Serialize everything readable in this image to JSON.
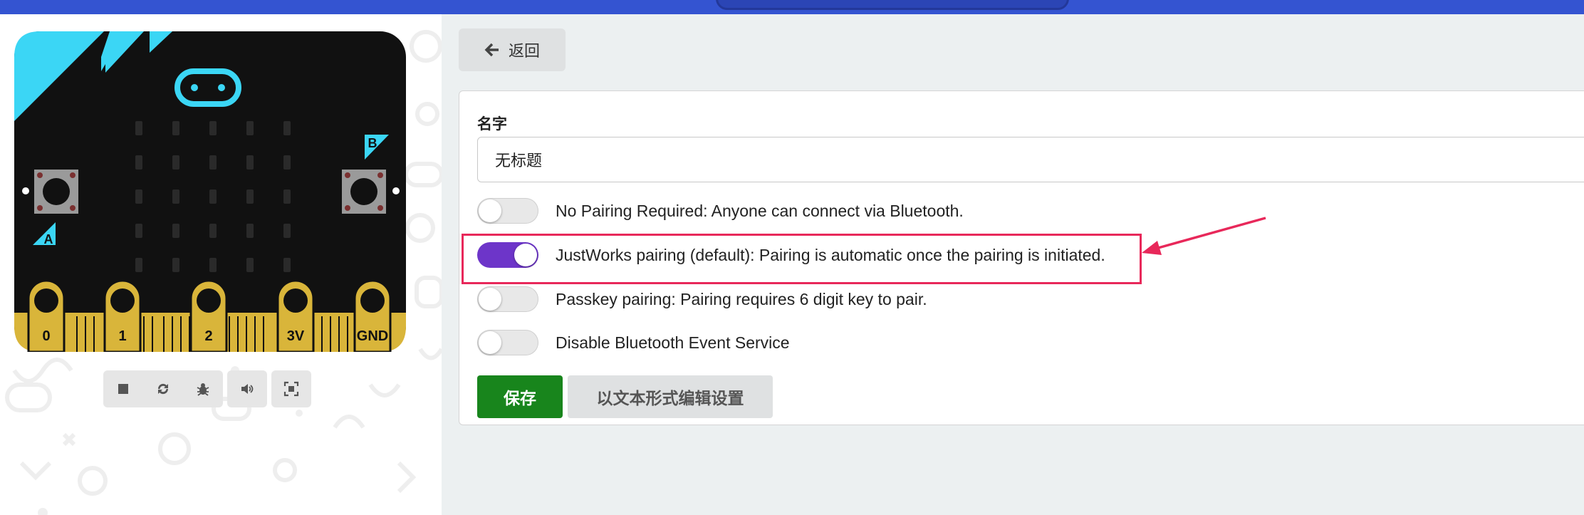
{
  "colors": {
    "topbar": "#3454d1",
    "accent_toggle": "#6d35c9",
    "save": "#18851c",
    "highlight": "#e8285a",
    "board_cyan": "#3bd6f5",
    "board_gold": "#d9b53a"
  },
  "simulator": {
    "buttons": {
      "a": "A",
      "b": "B"
    },
    "pins": [
      "0",
      "1",
      "2",
      "3V",
      "GND"
    ],
    "controls": [
      "stop-icon",
      "restart-icon",
      "debug-icon",
      "sound-icon",
      "fullscreen-icon"
    ]
  },
  "main": {
    "back_label": "返回",
    "name_label": "名字",
    "name_value": "无标题",
    "toggles": [
      {
        "label": "No Pairing Required: Anyone can connect via Bluetooth.",
        "on": false
      },
      {
        "label": "JustWorks pairing (default): Pairing is automatic once the pairing is initiated.",
        "on": true
      },
      {
        "label": "Passkey pairing: Pairing requires 6 digit key to pair.",
        "on": false
      },
      {
        "label": "Disable Bluetooth Event Service",
        "on": false
      }
    ],
    "save_label": "保存",
    "edit_text_label": "以文本形式编辑设置"
  }
}
